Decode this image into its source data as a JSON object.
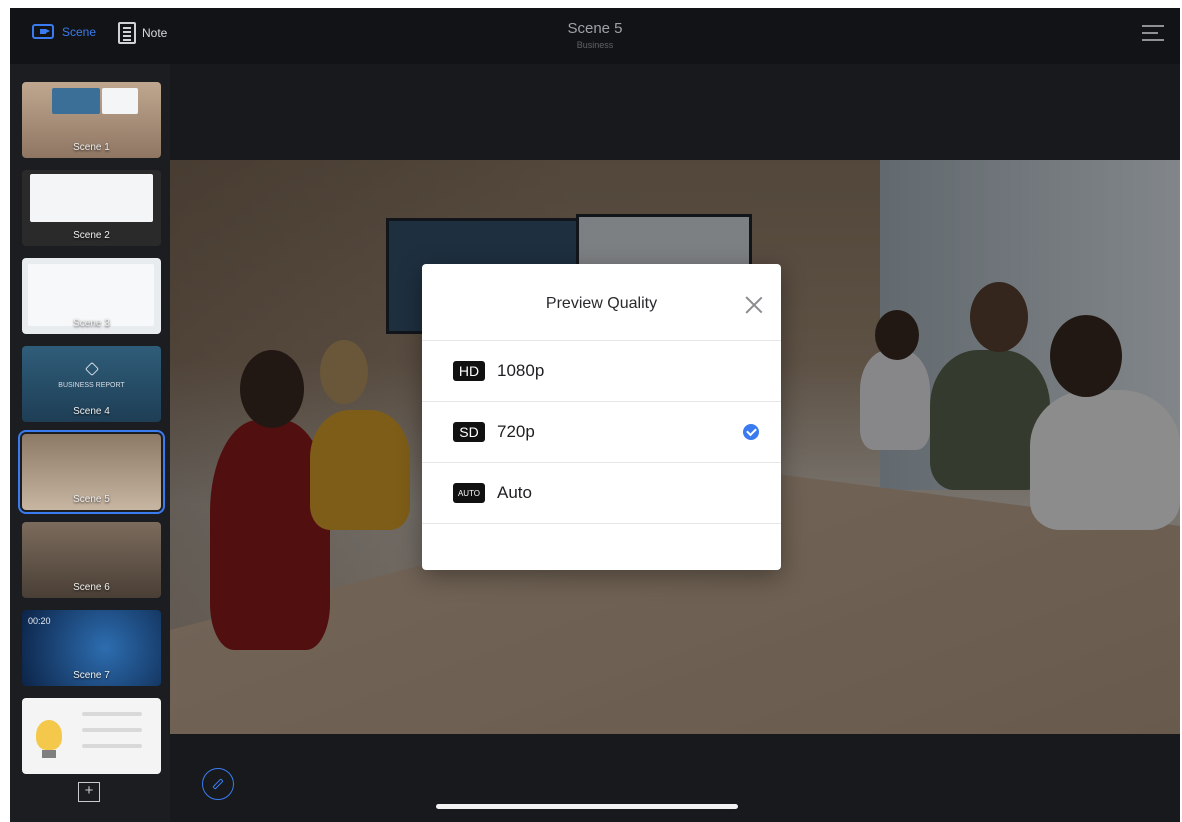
{
  "topbar": {
    "scene_label": "Scene",
    "note_label": "Note",
    "title": "Scene 5",
    "subtitle": "Business"
  },
  "sidebar": {
    "scenes": [
      {
        "label": "Scene 1"
      },
      {
        "label": "Scene 2"
      },
      {
        "label": "Scene 3"
      },
      {
        "label": "Scene 4",
        "slide_text": "BUSINESS REPORT"
      },
      {
        "label": "Scene 5",
        "active": true
      },
      {
        "label": "Scene 6"
      },
      {
        "label": "Scene 7",
        "time": "00:20"
      },
      {
        "label": ""
      }
    ],
    "add_label": "+"
  },
  "modal": {
    "title": "Preview Quality",
    "options": [
      {
        "badge": "HD",
        "label": "1080p",
        "selected": false
      },
      {
        "badge": "SD",
        "label": "720p",
        "selected": true
      },
      {
        "badge": "AUTO",
        "label": "Auto",
        "selected": false
      }
    ]
  },
  "colors": {
    "accent": "#3a7cf0",
    "topbar_bg": "#121316",
    "sidebar_bg": "#1b1d21"
  },
  "icons": [
    "scene-camera-icon",
    "note-icon",
    "menu-icon",
    "close-icon",
    "check-icon",
    "edit-pen-icon",
    "add-icon"
  ]
}
